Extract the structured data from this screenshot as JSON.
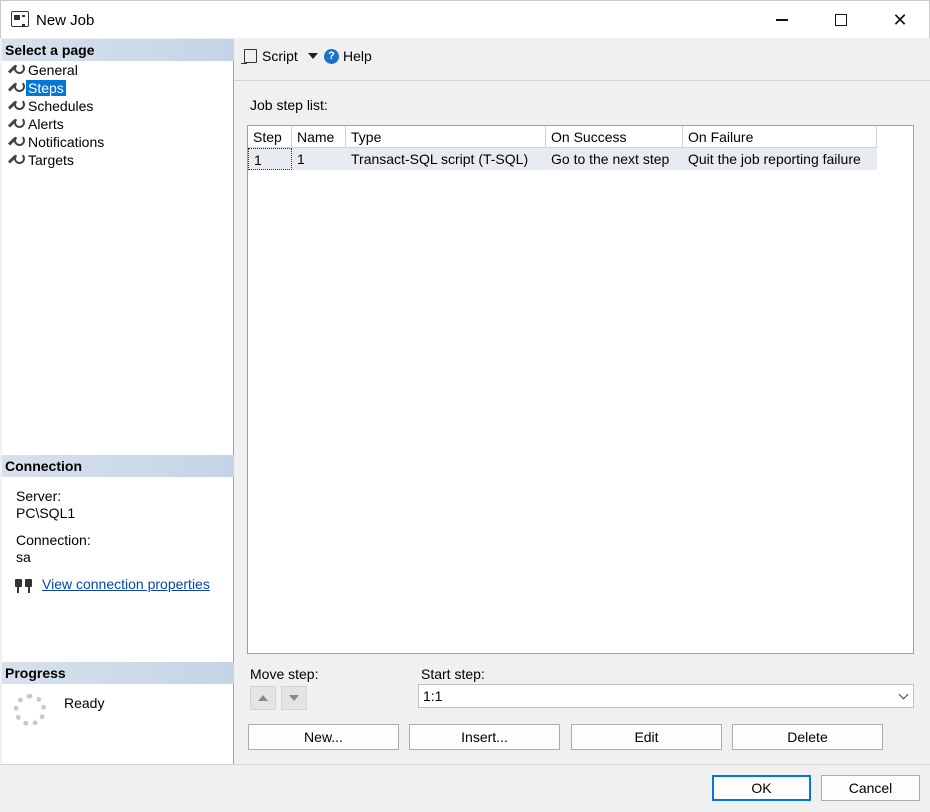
{
  "window": {
    "title": "New Job"
  },
  "left_panel": {
    "select_page_header": "Select a page",
    "pages": [
      {
        "label": "General",
        "selected": false
      },
      {
        "label": "Steps",
        "selected": true
      },
      {
        "label": "Schedules",
        "selected": false
      },
      {
        "label": "Alerts",
        "selected": false
      },
      {
        "label": "Notifications",
        "selected": false
      },
      {
        "label": "Targets",
        "selected": false
      }
    ],
    "connection_header": "Connection",
    "server_label": "Server:",
    "server_value": "PC\\SQL1",
    "connection_label": "Connection:",
    "connection_value": "sa",
    "view_connection_link": "View connection properties",
    "progress_header": "Progress",
    "progress_status": "Ready"
  },
  "toolbar": {
    "script_label": "Script",
    "help_label": "Help"
  },
  "main": {
    "job_step_list_label": "Job step list:",
    "columns": [
      "Step",
      "Name",
      "Type",
      "On Success",
      "On Failure"
    ],
    "rows": [
      {
        "step": "1",
        "name": "1",
        "type": "Transact-SQL script (T-SQL)",
        "on_success": "Go to the next step",
        "on_failure": "Quit the job reporting failure"
      }
    ],
    "move_step_label": "Move step:",
    "start_step_label": "Start step:",
    "start_step_value": "1:1",
    "new_button": "New...",
    "insert_button": "Insert...",
    "edit_button": "Edit",
    "delete_button": "Delete"
  },
  "footer": {
    "ok_button": "OK",
    "cancel_button": "Cancel"
  },
  "colors": {
    "selection": "#0078d7",
    "header_gradient_start": "#d7e1ec",
    "header_gradient_end": "#c4d4e6",
    "link": "#0645ad"
  }
}
